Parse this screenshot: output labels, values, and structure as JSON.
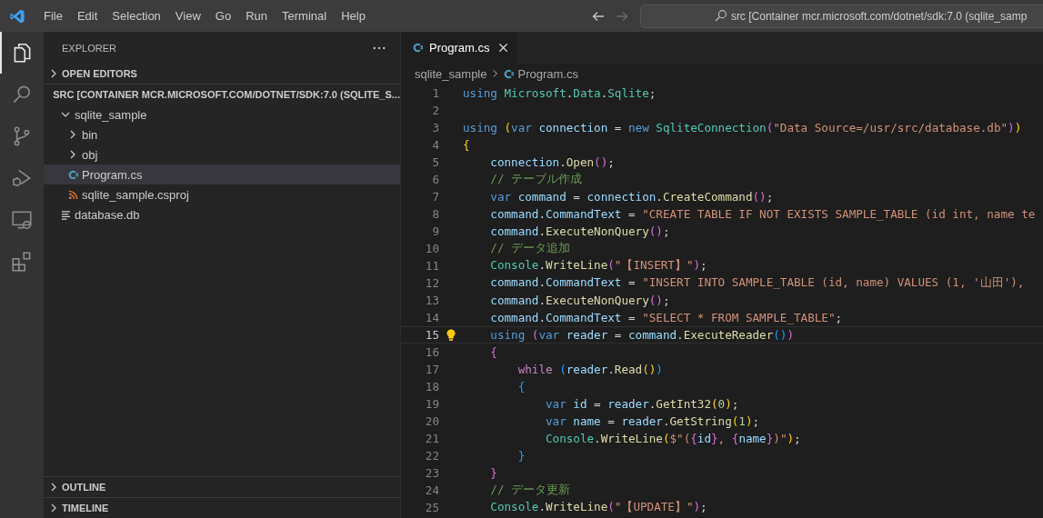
{
  "menu": [
    "File",
    "Edit",
    "Selection",
    "View",
    "Go",
    "Run",
    "Terminal",
    "Help"
  ],
  "nav": [
    {
      "disabled": false
    },
    {
      "disabled": true
    }
  ],
  "command_center": {
    "value": "src [Container mcr.microsoft.com/dotnet/sdk:7.0 (sqlite_samp"
  },
  "activity_bar": [
    {
      "selected": true
    },
    {
      "selected": false
    },
    {
      "selected": false
    },
    {
      "selected": false
    },
    {
      "selected": false
    },
    {
      "selected": false
    }
  ],
  "explorer": {
    "title": "EXPLORER",
    "sections": [
      {
        "title": "OPEN EDITORS",
        "expanded": false
      },
      {
        "title": "SRC [CONTAINER MCR.MICROSOFT.COM/DOTNET/SDK:7.0 (SQLITE_S...",
        "expanded": true,
        "items": [
          {
            "label": "sqlite_sample",
            "kind": "folder",
            "expanded": true,
            "selected": false,
            "children": [
              {
                "label": "bin",
                "kind": "folder",
                "expanded": false,
                "selected": false
              },
              {
                "label": "obj",
                "kind": "folder",
                "expanded": false,
                "selected": false
              },
              {
                "label": "Program.cs",
                "kind": "csharp",
                "selected": true
              },
              {
                "label": "sqlite_sample.csproj",
                "kind": "project",
                "selected": false
              }
            ]
          },
          {
            "label": "database.db",
            "kind": "text",
            "selected": false
          }
        ]
      },
      {
        "title": "OUTLINE",
        "expanded": false
      },
      {
        "title": "TIMELINE",
        "expanded": false
      }
    ]
  },
  "tabs": [
    {
      "label": "Program.cs",
      "selected": true
    }
  ],
  "breadcrumb": [
    "sqlite_sample",
    "Program.cs"
  ],
  "editor": {
    "lines": [
      {
        "number": "1",
        "current": false,
        "tokens": [
          {
            "kind": "kw",
            "text": "using "
          },
          {
            "kind": "type",
            "text": "Microsoft"
          },
          {
            "kind": "plain",
            "text": "."
          },
          {
            "kind": "type",
            "text": "Data"
          },
          {
            "kind": "plain",
            "text": "."
          },
          {
            "kind": "type",
            "text": "Sqlite"
          },
          {
            "kind": "plain",
            "text": ";"
          }
        ]
      },
      {
        "number": "2",
        "current": false
      },
      {
        "number": "3",
        "current": false,
        "tokens": [
          {
            "kind": "kw",
            "text": "using "
          },
          {
            "kind": "b1",
            "text": "("
          },
          {
            "kind": "kw",
            "text": "var "
          },
          {
            "kind": "var",
            "text": "connection "
          },
          {
            "kind": "plain",
            "text": "= "
          },
          {
            "kind": "kw",
            "text": "new "
          },
          {
            "kind": "type",
            "text": "SqliteConnection"
          },
          {
            "kind": "b2",
            "text": "("
          },
          {
            "kind": "str",
            "text": "\"Data Source=/usr/src/database.db\""
          },
          {
            "kind": "b2",
            "text": ")"
          },
          {
            "kind": "b1",
            "text": ")"
          }
        ]
      },
      {
        "number": "4",
        "current": false,
        "tokens": [
          {
            "kind": "b1",
            "text": "{"
          }
        ]
      },
      {
        "number": "5",
        "current": false,
        "tokens": [
          {
            "kind": "var",
            "text": "    connection"
          },
          {
            "kind": "plain",
            "text": "."
          },
          {
            "kind": "fn",
            "text": "Open"
          },
          {
            "kind": "b2",
            "text": "()"
          },
          {
            "kind": "plain",
            "text": ";"
          }
        ]
      },
      {
        "number": "6",
        "current": false,
        "tokens": [
          {
            "kind": "com",
            "text": "    // テーブル作成"
          }
        ]
      },
      {
        "number": "7",
        "current": false,
        "tokens": [
          {
            "kind": "kw",
            "text": "    var "
          },
          {
            "kind": "var",
            "text": "command "
          },
          {
            "kind": "plain",
            "text": "= "
          },
          {
            "kind": "var",
            "text": "connection"
          },
          {
            "kind": "plain",
            "text": "."
          },
          {
            "kind": "fn",
            "text": "CreateCommand"
          },
          {
            "kind": "b2",
            "text": "()"
          },
          {
            "kind": "plain",
            "text": ";"
          }
        ]
      },
      {
        "number": "8",
        "current": false,
        "tokens": [
          {
            "kind": "var",
            "text": "    command"
          },
          {
            "kind": "plain",
            "text": "."
          },
          {
            "kind": "var",
            "text": "CommandText "
          },
          {
            "kind": "plain",
            "text": "= "
          },
          {
            "kind": "str",
            "text": "\"CREATE TABLE IF NOT EXISTS SAMPLE_TABLE (id int, name te"
          }
        ]
      },
      {
        "number": "9",
        "current": false,
        "tokens": [
          {
            "kind": "var",
            "text": "    command"
          },
          {
            "kind": "plain",
            "text": "."
          },
          {
            "kind": "fn",
            "text": "ExecuteNonQuery"
          },
          {
            "kind": "b2",
            "text": "()"
          },
          {
            "kind": "plain",
            "text": ";"
          }
        ]
      },
      {
        "number": "10",
        "current": false,
        "tokens": [
          {
            "kind": "com",
            "text": "    // データ追加"
          }
        ]
      },
      {
        "number": "11",
        "current": false,
        "tokens": [
          {
            "kind": "type",
            "text": "    Console"
          },
          {
            "kind": "plain",
            "text": "."
          },
          {
            "kind": "fn",
            "text": "WriteLine"
          },
          {
            "kind": "b2",
            "text": "("
          },
          {
            "kind": "str",
            "text": "\"【INSERT】\""
          },
          {
            "kind": "b2",
            "text": ")"
          },
          {
            "kind": "plain",
            "text": ";"
          }
        ]
      },
      {
        "number": "12",
        "current": false,
        "tokens": [
          {
            "kind": "var",
            "text": "    command"
          },
          {
            "kind": "plain",
            "text": "."
          },
          {
            "kind": "var",
            "text": "CommandText "
          },
          {
            "kind": "plain",
            "text": "= "
          },
          {
            "kind": "str",
            "text": "\"INSERT INTO SAMPLE_TABLE (id, name) VALUES (1, '山田'),"
          }
        ]
      },
      {
        "number": "13",
        "current": false,
        "tokens": [
          {
            "kind": "var",
            "text": "    command"
          },
          {
            "kind": "plain",
            "text": "."
          },
          {
            "kind": "fn",
            "text": "ExecuteNonQuery"
          },
          {
            "kind": "b2",
            "text": "()"
          },
          {
            "kind": "plain",
            "text": ";"
          }
        ]
      },
      {
        "number": "14",
        "current": false,
        "tokens": [
          {
            "kind": "var",
            "text": "    command"
          },
          {
            "kind": "plain",
            "text": "."
          },
          {
            "kind": "var",
            "text": "CommandText "
          },
          {
            "kind": "plain",
            "text": "= "
          },
          {
            "kind": "str",
            "text": "\"SELECT * FROM SAMPLE_TABLE\""
          },
          {
            "kind": "plain",
            "text": ";"
          }
        ]
      },
      {
        "number": "15",
        "current": true,
        "tokens": [
          {
            "kind": "kw",
            "text": "    using "
          },
          {
            "kind": "b2",
            "text": "("
          },
          {
            "kind": "kw",
            "text": "var "
          },
          {
            "kind": "var",
            "text": "reader "
          },
          {
            "kind": "plain",
            "text": "= "
          },
          {
            "kind": "var",
            "text": "command"
          },
          {
            "kind": "plain",
            "text": "."
          },
          {
            "kind": "fn",
            "text": "ExecuteReader"
          },
          {
            "kind": "b3",
            "text": "()"
          },
          {
            "kind": "b2",
            "text": ")"
          }
        ]
      },
      {
        "number": "16",
        "current": false,
        "tokens": [
          {
            "kind": "b2",
            "text": "    {"
          }
        ]
      },
      {
        "number": "17",
        "current": false,
        "tokens": [
          {
            "kind": "ctl",
            "text": "        while "
          },
          {
            "kind": "b3",
            "text": "("
          },
          {
            "kind": "var",
            "text": "reader"
          },
          {
            "kind": "plain",
            "text": "."
          },
          {
            "kind": "fn",
            "text": "Read"
          },
          {
            "kind": "b1",
            "text": "()"
          },
          {
            "kind": "b3",
            "text": ")"
          }
        ]
      },
      {
        "number": "18",
        "current": false,
        "tokens": [
          {
            "kind": "b3",
            "text": "        {"
          }
        ]
      },
      {
        "number": "19",
        "current": false,
        "tokens": [
          {
            "kind": "kw",
            "text": "            var "
          },
          {
            "kind": "var",
            "text": "id "
          },
          {
            "kind": "plain",
            "text": "= "
          },
          {
            "kind": "var",
            "text": "reader"
          },
          {
            "kind": "plain",
            "text": "."
          },
          {
            "kind": "fn",
            "text": "GetInt32"
          },
          {
            "kind": "b1",
            "text": "("
          },
          {
            "kind": "num",
            "text": "0"
          },
          {
            "kind": "b1",
            "text": ")"
          },
          {
            "kind": "plain",
            "text": ";"
          }
        ]
      },
      {
        "number": "20",
        "current": false,
        "tokens": [
          {
            "kind": "kw",
            "text": "            var "
          },
          {
            "kind": "var",
            "text": "name "
          },
          {
            "kind": "plain",
            "text": "= "
          },
          {
            "kind": "var",
            "text": "reader"
          },
          {
            "kind": "plain",
            "text": "."
          },
          {
            "kind": "fn",
            "text": "GetString"
          },
          {
            "kind": "b1",
            "text": "("
          },
          {
            "kind": "num",
            "text": "1"
          },
          {
            "kind": "b1",
            "text": ")"
          },
          {
            "kind": "plain",
            "text": ";"
          }
        ]
      },
      {
        "number": "21",
        "current": false,
        "tokens": [
          {
            "kind": "type",
            "text": "            Console"
          },
          {
            "kind": "plain",
            "text": "."
          },
          {
            "kind": "fn",
            "text": "WriteLine"
          },
          {
            "kind": "b1",
            "text": "("
          },
          {
            "kind": "str",
            "text": "$\"("
          },
          {
            "kind": "b2",
            "text": "{"
          },
          {
            "kind": "var",
            "text": "id"
          },
          {
            "kind": "b2",
            "text": "}"
          },
          {
            "kind": "str",
            "text": ", "
          },
          {
            "kind": "b2",
            "text": "{"
          },
          {
            "kind": "var",
            "text": "name"
          },
          {
            "kind": "b2",
            "text": "}"
          },
          {
            "kind": "str",
            "text": ")\""
          },
          {
            "kind": "b1",
            "text": ")"
          },
          {
            "kind": "plain",
            "text": ";"
          }
        ]
      },
      {
        "number": "22",
        "current": false,
        "tokens": [
          {
            "kind": "b3",
            "text": "        }"
          }
        ]
      },
      {
        "number": "23",
        "current": false,
        "tokens": [
          {
            "kind": "b2",
            "text": "    }"
          }
        ]
      },
      {
        "number": "24",
        "current": false,
        "tokens": [
          {
            "kind": "com",
            "text": "    // データ更新"
          }
        ]
      },
      {
        "number": "25",
        "current": false,
        "tokens": [
          {
            "kind": "type",
            "text": "    Console"
          },
          {
            "kind": "plain",
            "text": "."
          },
          {
            "kind": "fn",
            "text": "WriteLine"
          },
          {
            "kind": "b2",
            "text": "("
          },
          {
            "kind": "str",
            "text": "\"【UPDATE】\""
          },
          {
            "kind": "b2",
            "text": ")"
          },
          {
            "kind": "plain",
            "text": ";"
          }
        ]
      }
    ]
  }
}
